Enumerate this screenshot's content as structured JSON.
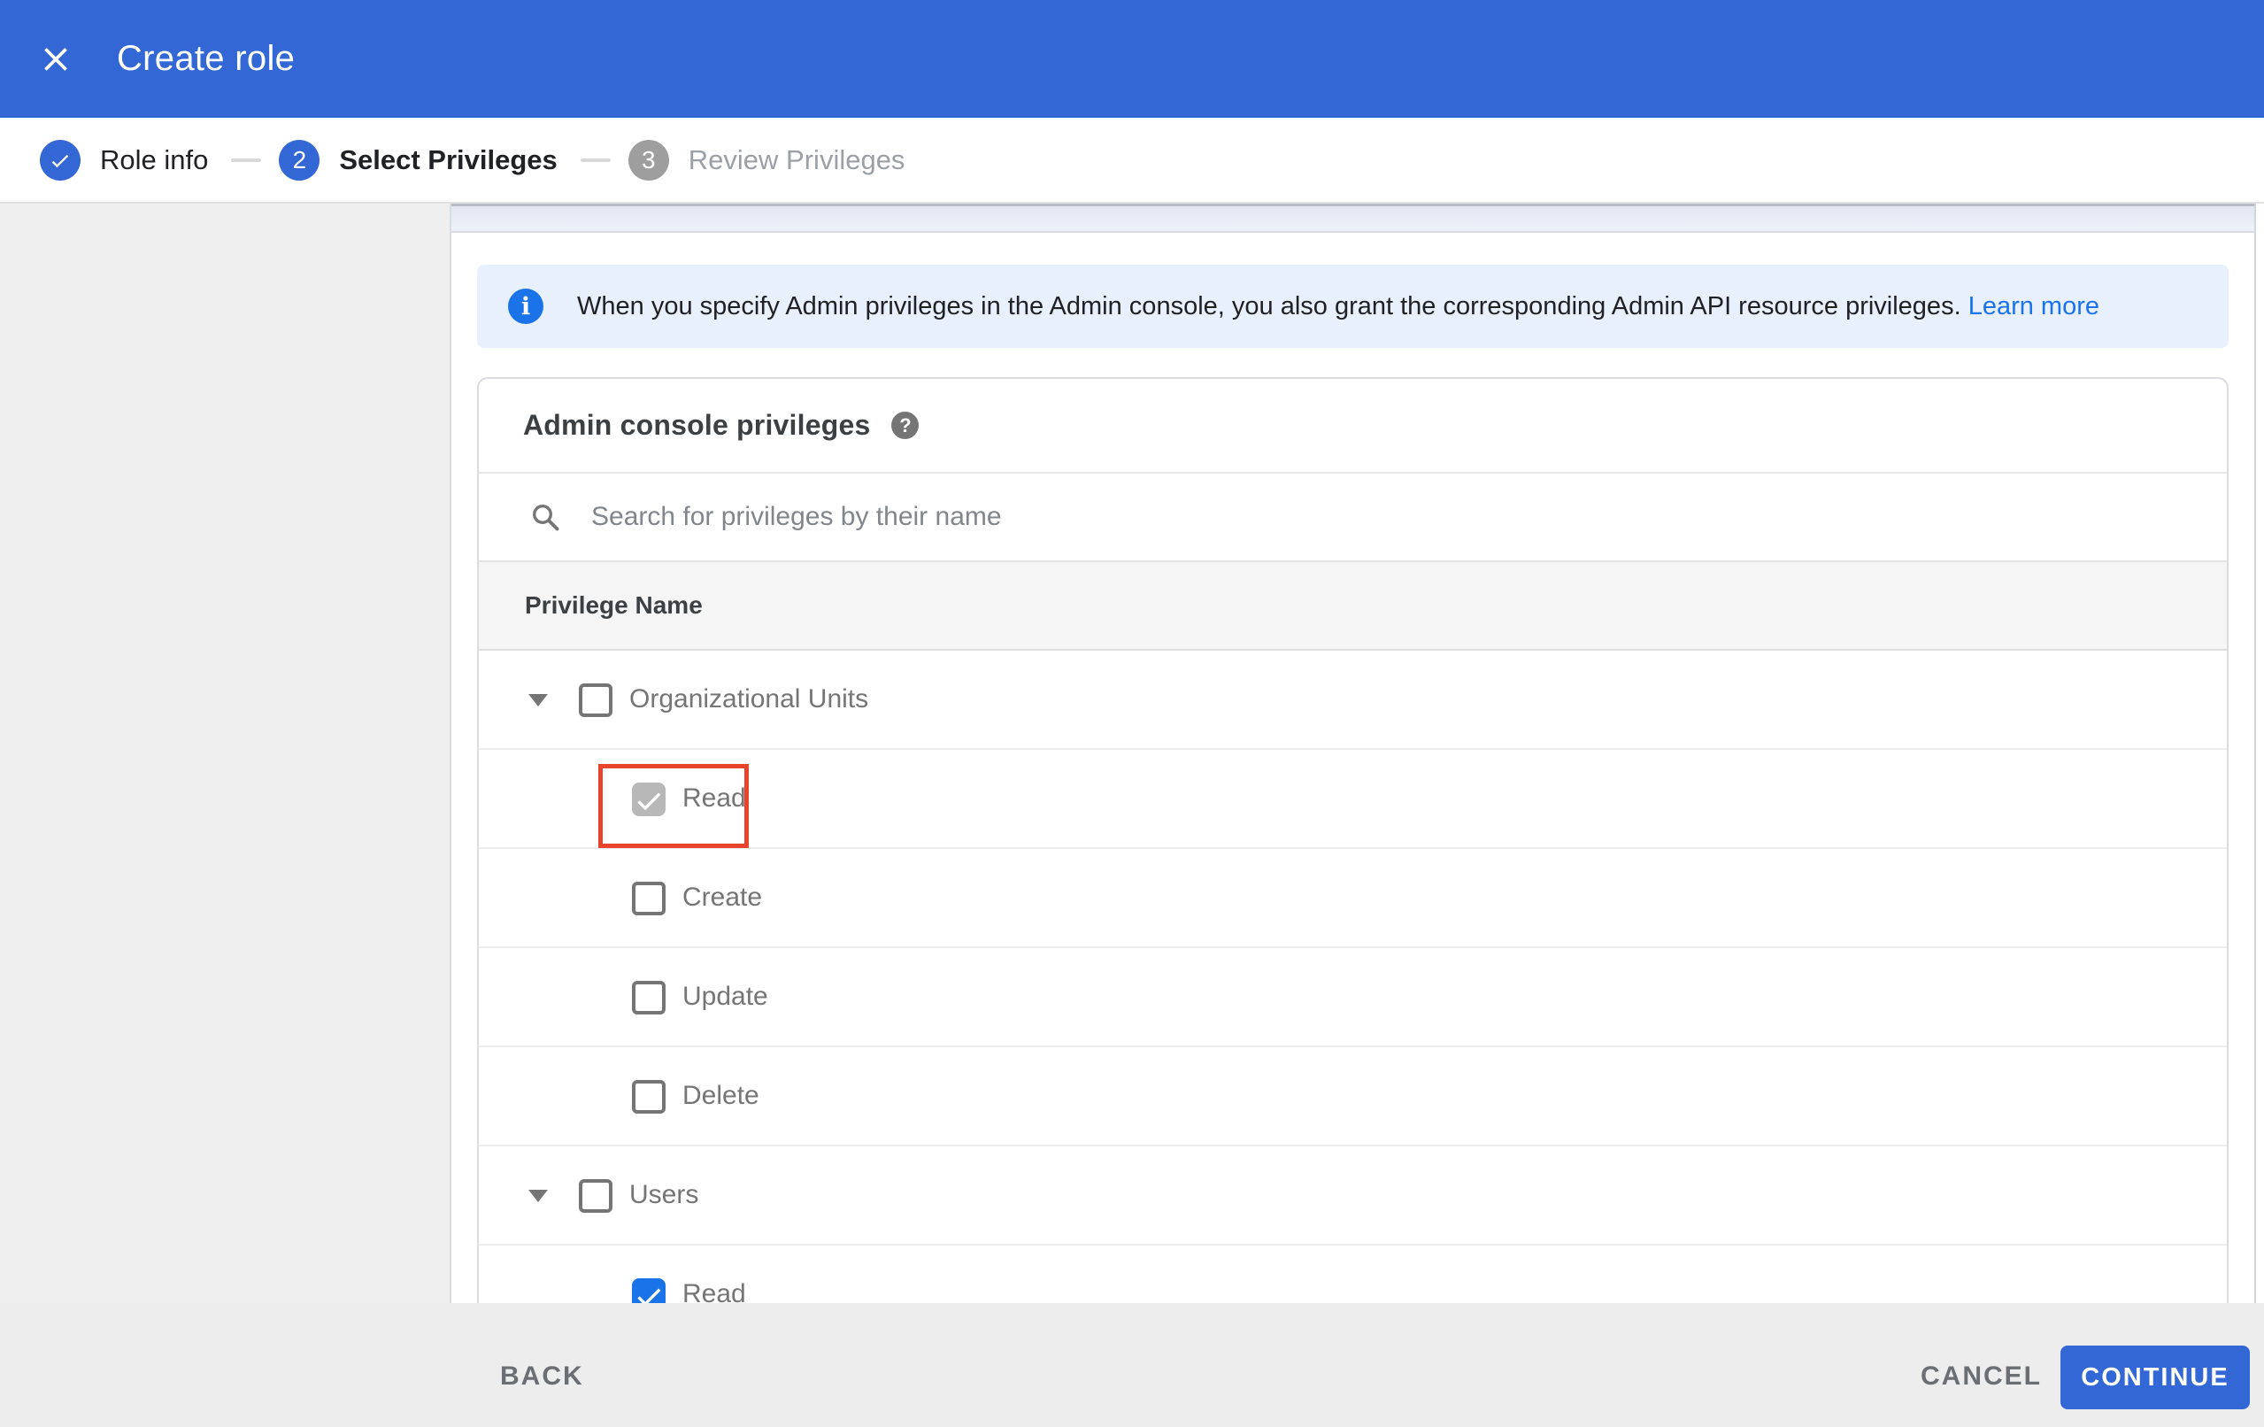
{
  "app_bar": {
    "title": "Create role"
  },
  "stepper": {
    "steps": [
      {
        "num": "1",
        "label": "Role info",
        "state": "complete"
      },
      {
        "num": "2",
        "label": "Select Privileges",
        "state": "active"
      },
      {
        "num": "3",
        "label": "Review Privileges",
        "state": "upcoming"
      }
    ]
  },
  "banner": {
    "text": "When you specify Admin privileges in the Admin console, you also grant the corresponding Admin API resource privileges.",
    "link_label": "Learn more"
  },
  "card": {
    "title": "Admin console privileges",
    "help_icon": "help-icon",
    "search_placeholder": "Search for privileges by their name",
    "table_header": "Privilege Name"
  },
  "privileges": [
    {
      "label": "Organizational Units",
      "type": "parent",
      "checked": false,
      "expanded": true
    },
    {
      "label": "Read",
      "type": "child",
      "checked": true,
      "disabled": true,
      "highlighted": true
    },
    {
      "label": "Create",
      "type": "child",
      "checked": false
    },
    {
      "label": "Update",
      "type": "child",
      "checked": false
    },
    {
      "label": "Delete",
      "type": "child",
      "checked": false
    },
    {
      "label": "Users",
      "type": "parent",
      "checked": false,
      "expanded": true
    },
    {
      "label": "Read",
      "type": "child",
      "checked": true
    }
  ],
  "footer": {
    "back_label": "BACK",
    "cancel_label": "CANCEL",
    "continue_label": "CONTINUE"
  },
  "colors": {
    "accent_blue": "#3367d6",
    "link_blue": "#1a73e8",
    "banner_bg": "#e8f0fe",
    "highlight_red": "#e8432c",
    "disabled_check": "#b8b8b8"
  }
}
